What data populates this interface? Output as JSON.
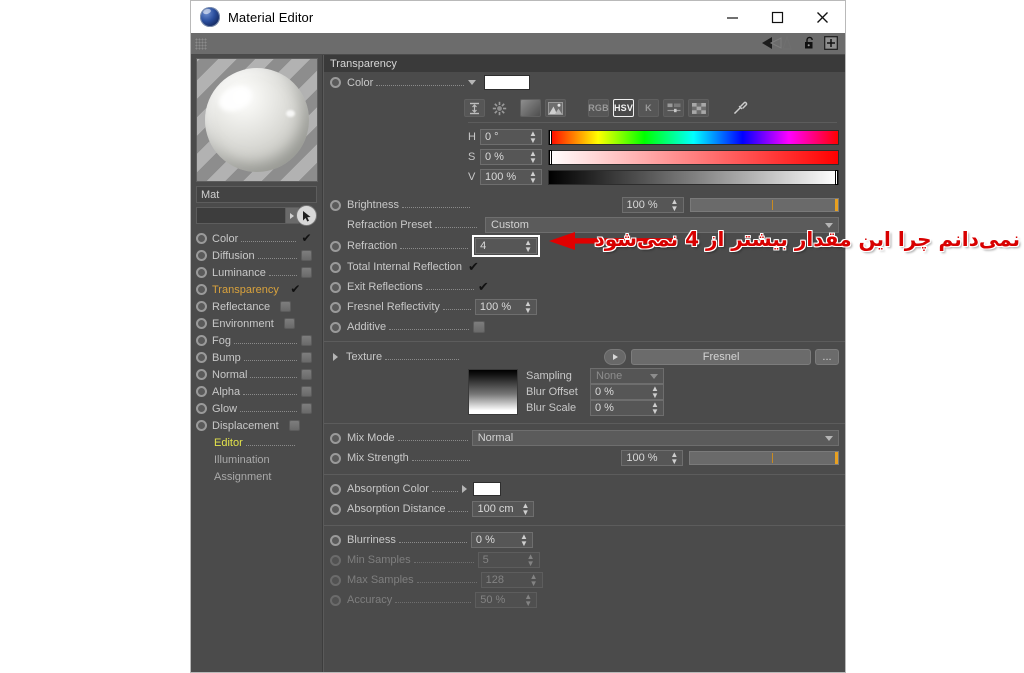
{
  "window": {
    "title": "Material Editor",
    "app_icon": "cinema4d-icon",
    "controls": {
      "minimize": "minimize-icon",
      "maximize": "maximize-icon",
      "close": "close-icon"
    }
  },
  "toolstrip": {
    "grip": "grip-handle-icon",
    "icons": [
      "back-arrow-icon",
      "forward-arrow-icon",
      "lock-icon",
      "add-icon"
    ]
  },
  "material": {
    "preview_name": "material-preview",
    "name": "Mat",
    "path_value": "",
    "channels": [
      {
        "label": "Color",
        "state": "checked"
      },
      {
        "label": "Diffusion",
        "state": "unchecked"
      },
      {
        "label": "Luminance",
        "state": "unchecked"
      },
      {
        "label": "Transparency",
        "state": "checked",
        "active": true
      },
      {
        "label": "Reflectance",
        "state": "unchecked"
      },
      {
        "label": "Environment",
        "state": "unchecked"
      },
      {
        "label": "Fog",
        "state": "unchecked"
      },
      {
        "label": "Bump",
        "state": "unchecked"
      },
      {
        "label": "Normal",
        "state": "unchecked"
      },
      {
        "label": "Alpha",
        "state": "unchecked"
      },
      {
        "label": "Glow",
        "state": "unchecked"
      },
      {
        "label": "Displacement",
        "state": "unchecked"
      }
    ],
    "pages": [
      {
        "label": "Editor",
        "selected": true
      },
      {
        "label": "Illumination",
        "selected": false
      },
      {
        "label": "Assignment",
        "selected": false
      }
    ]
  },
  "panel": {
    "section_title": "Transparency",
    "color": {
      "label": "Color",
      "swatch_hex": "#ffffff",
      "mode_buttons": [
        {
          "name": "swap-colors-icon",
          "label": ""
        },
        {
          "name": "color-wheel-icon",
          "label": ""
        },
        {
          "name": "gradient-icon",
          "label": ""
        },
        {
          "name": "image-picker-icon",
          "label": ""
        }
      ],
      "model_buttons": [
        {
          "name": "rgb-mode-button",
          "label": "RGB",
          "selected": false
        },
        {
          "name": "hsv-mode-button",
          "label": "HSV",
          "selected": true
        },
        {
          "name": "kelvin-mode-button",
          "label": "K",
          "selected": false
        },
        {
          "name": "sliders-mode-button",
          "label": "",
          "selected": false
        },
        {
          "name": "swatches-mode-button",
          "label": "",
          "selected": false
        }
      ],
      "eyedropper": "eyedropper-icon",
      "channels": [
        {
          "key": "H",
          "value": "0 °",
          "knob_pct": 0
        },
        {
          "key": "S",
          "value": "0 %",
          "knob_pct": 0
        },
        {
          "key": "V",
          "value": "100 %",
          "knob_pct": 100
        }
      ]
    },
    "brightness": {
      "label": "Brightness",
      "value": "100 %",
      "slider_pct": 100
    },
    "refraction_preset": {
      "label": "Refraction Preset",
      "value": "Custom"
    },
    "refraction": {
      "label": "Refraction",
      "value": "4",
      "highlighted": true
    },
    "total_internal_reflection": {
      "label": "Total Internal Reflection",
      "checked": true
    },
    "exit_reflections": {
      "label": "Exit Reflections",
      "checked": true
    },
    "fresnel_reflectivity": {
      "label": "Fresnel Reflectivity",
      "value": "100 %"
    },
    "additive": {
      "label": "Additive",
      "checked": false
    },
    "texture": {
      "label": "Texture",
      "value": "Fresnel",
      "more_button": "...",
      "sampling": {
        "label": "Sampling",
        "value": "None"
      },
      "blur_offset": {
        "label": "Blur Offset",
        "value": "0 %"
      },
      "blur_scale": {
        "label": "Blur Scale",
        "value": "0 %"
      }
    },
    "mix_mode": {
      "label": "Mix Mode",
      "value": "Normal"
    },
    "mix_strength": {
      "label": "Mix Strength",
      "value": "100 %",
      "slider_pct": 100
    },
    "absorption_color": {
      "label": "Absorption Color",
      "swatch_hex": "#ffffff"
    },
    "absorption_distance": {
      "label": "Absorption Distance",
      "value": "100 cm"
    },
    "blurriness": {
      "label": "Blurriness",
      "value": "0 %",
      "enabled": true
    },
    "min_samples": {
      "label": "Min Samples",
      "value": "5",
      "enabled": false
    },
    "max_samples": {
      "label": "Max Samples",
      "value": "128",
      "enabled": false
    },
    "accuracy": {
      "label": "Accuracy",
      "value": "50 %",
      "enabled": false
    }
  },
  "annotation": {
    "text": "نمی‌دانم چرا این مقدار بیشتر از 4 نمی‌شود",
    "arrow": "red-arrow-pointing-left",
    "color": "#d80000"
  }
}
